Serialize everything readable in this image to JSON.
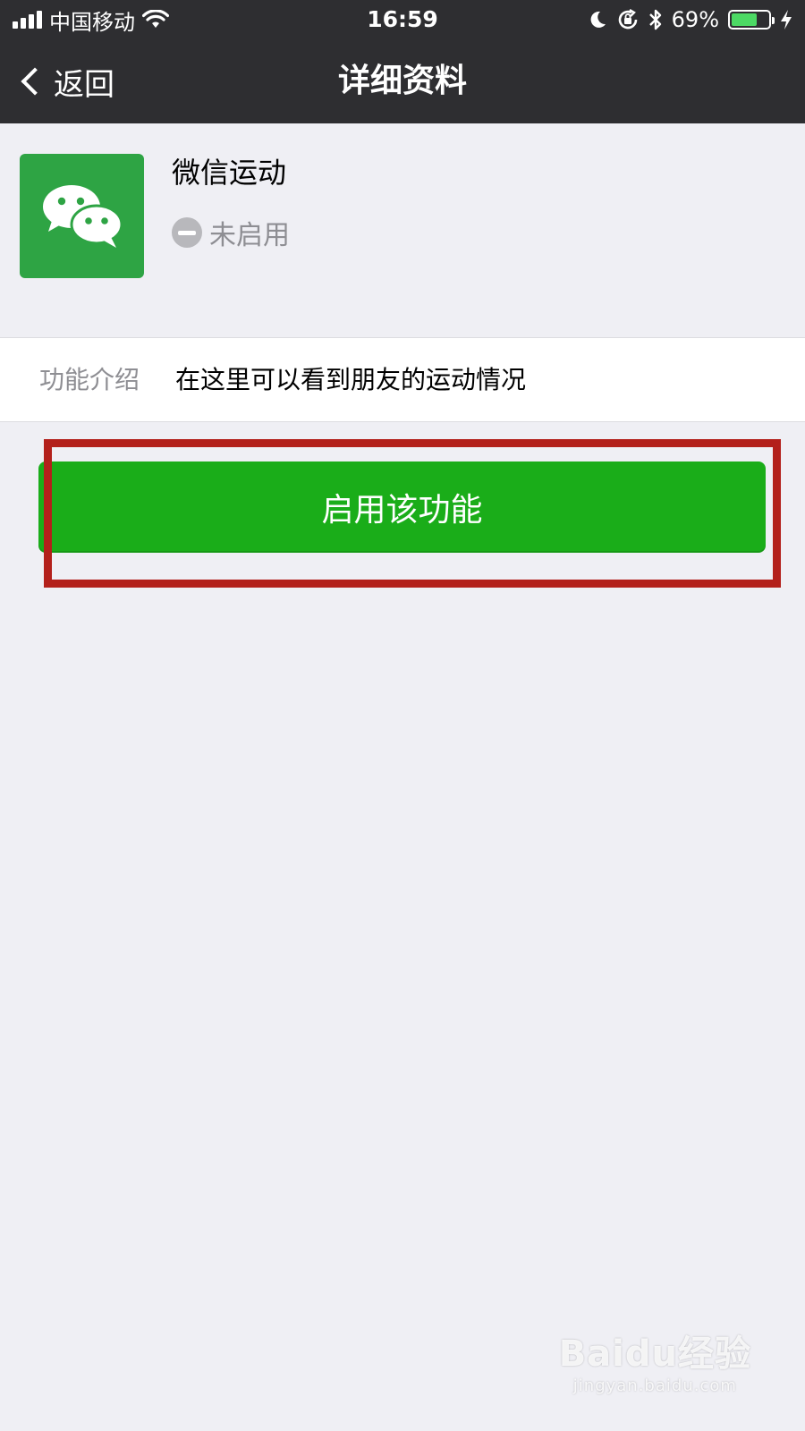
{
  "status_bar": {
    "carrier": "中国移动",
    "time": "16:59",
    "battery_percent": "69%",
    "battery_level": 0.69,
    "icons": [
      "signal-icon",
      "wifi-icon",
      "moon-icon",
      "rotation-lock-icon",
      "bluetooth-icon",
      "battery-icon",
      "charging-icon"
    ]
  },
  "nav": {
    "back_label": "返回",
    "title": "详细资料"
  },
  "app": {
    "name": "微信运动",
    "status": "未启用",
    "icon": "wechat-icon",
    "icon_color": "#2ea444"
  },
  "info": {
    "label": "功能介绍",
    "value": "在这里可以看到朋友的运动情况"
  },
  "actions": {
    "enable_label": "启用该功能",
    "accent": "#1aad19",
    "highlight_color": "#b3201b"
  },
  "watermark": {
    "logo": "Baidu经验",
    "url": "jingyan.baidu.com"
  }
}
